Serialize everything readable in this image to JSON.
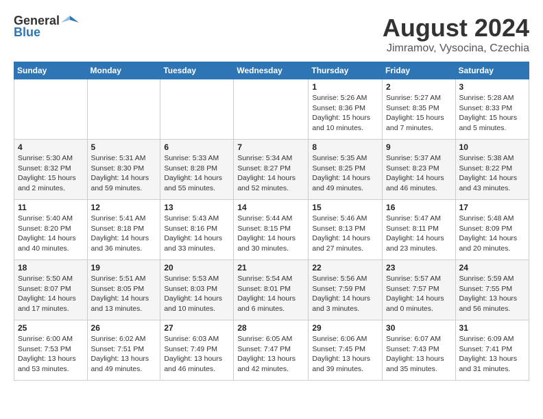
{
  "header": {
    "logo_general": "General",
    "logo_blue": "Blue",
    "month_title": "August 2024",
    "location": "Jimramov, Vysocina, Czechia"
  },
  "days_of_week": [
    "Sunday",
    "Monday",
    "Tuesday",
    "Wednesday",
    "Thursday",
    "Friday",
    "Saturday"
  ],
  "weeks": [
    [
      {
        "day": "",
        "info": ""
      },
      {
        "day": "",
        "info": ""
      },
      {
        "day": "",
        "info": ""
      },
      {
        "day": "",
        "info": ""
      },
      {
        "day": "1",
        "info": "Sunrise: 5:26 AM\nSunset: 8:36 PM\nDaylight: 15 hours\nand 10 minutes."
      },
      {
        "day": "2",
        "info": "Sunrise: 5:27 AM\nSunset: 8:35 PM\nDaylight: 15 hours\nand 7 minutes."
      },
      {
        "day": "3",
        "info": "Sunrise: 5:28 AM\nSunset: 8:33 PM\nDaylight: 15 hours\nand 5 minutes."
      }
    ],
    [
      {
        "day": "4",
        "info": "Sunrise: 5:30 AM\nSunset: 8:32 PM\nDaylight: 15 hours\nand 2 minutes."
      },
      {
        "day": "5",
        "info": "Sunrise: 5:31 AM\nSunset: 8:30 PM\nDaylight: 14 hours\nand 59 minutes."
      },
      {
        "day": "6",
        "info": "Sunrise: 5:33 AM\nSunset: 8:28 PM\nDaylight: 14 hours\nand 55 minutes."
      },
      {
        "day": "7",
        "info": "Sunrise: 5:34 AM\nSunset: 8:27 PM\nDaylight: 14 hours\nand 52 minutes."
      },
      {
        "day": "8",
        "info": "Sunrise: 5:35 AM\nSunset: 8:25 PM\nDaylight: 14 hours\nand 49 minutes."
      },
      {
        "day": "9",
        "info": "Sunrise: 5:37 AM\nSunset: 8:23 PM\nDaylight: 14 hours\nand 46 minutes."
      },
      {
        "day": "10",
        "info": "Sunrise: 5:38 AM\nSunset: 8:22 PM\nDaylight: 14 hours\nand 43 minutes."
      }
    ],
    [
      {
        "day": "11",
        "info": "Sunrise: 5:40 AM\nSunset: 8:20 PM\nDaylight: 14 hours\nand 40 minutes."
      },
      {
        "day": "12",
        "info": "Sunrise: 5:41 AM\nSunset: 8:18 PM\nDaylight: 14 hours\nand 36 minutes."
      },
      {
        "day": "13",
        "info": "Sunrise: 5:43 AM\nSunset: 8:16 PM\nDaylight: 14 hours\nand 33 minutes."
      },
      {
        "day": "14",
        "info": "Sunrise: 5:44 AM\nSunset: 8:15 PM\nDaylight: 14 hours\nand 30 minutes."
      },
      {
        "day": "15",
        "info": "Sunrise: 5:46 AM\nSunset: 8:13 PM\nDaylight: 14 hours\nand 27 minutes."
      },
      {
        "day": "16",
        "info": "Sunrise: 5:47 AM\nSunset: 8:11 PM\nDaylight: 14 hours\nand 23 minutes."
      },
      {
        "day": "17",
        "info": "Sunrise: 5:48 AM\nSunset: 8:09 PM\nDaylight: 14 hours\nand 20 minutes."
      }
    ],
    [
      {
        "day": "18",
        "info": "Sunrise: 5:50 AM\nSunset: 8:07 PM\nDaylight: 14 hours\nand 17 minutes."
      },
      {
        "day": "19",
        "info": "Sunrise: 5:51 AM\nSunset: 8:05 PM\nDaylight: 14 hours\nand 13 minutes."
      },
      {
        "day": "20",
        "info": "Sunrise: 5:53 AM\nSunset: 8:03 PM\nDaylight: 14 hours\nand 10 minutes."
      },
      {
        "day": "21",
        "info": "Sunrise: 5:54 AM\nSunset: 8:01 PM\nDaylight: 14 hours\nand 6 minutes."
      },
      {
        "day": "22",
        "info": "Sunrise: 5:56 AM\nSunset: 7:59 PM\nDaylight: 14 hours\nand 3 minutes."
      },
      {
        "day": "23",
        "info": "Sunrise: 5:57 AM\nSunset: 7:57 PM\nDaylight: 14 hours\nand 0 minutes."
      },
      {
        "day": "24",
        "info": "Sunrise: 5:59 AM\nSunset: 7:55 PM\nDaylight: 13 hours\nand 56 minutes."
      }
    ],
    [
      {
        "day": "25",
        "info": "Sunrise: 6:00 AM\nSunset: 7:53 PM\nDaylight: 13 hours\nand 53 minutes."
      },
      {
        "day": "26",
        "info": "Sunrise: 6:02 AM\nSunset: 7:51 PM\nDaylight: 13 hours\nand 49 minutes."
      },
      {
        "day": "27",
        "info": "Sunrise: 6:03 AM\nSunset: 7:49 PM\nDaylight: 13 hours\nand 46 minutes."
      },
      {
        "day": "28",
        "info": "Sunrise: 6:05 AM\nSunset: 7:47 PM\nDaylight: 13 hours\nand 42 minutes."
      },
      {
        "day": "29",
        "info": "Sunrise: 6:06 AM\nSunset: 7:45 PM\nDaylight: 13 hours\nand 39 minutes."
      },
      {
        "day": "30",
        "info": "Sunrise: 6:07 AM\nSunset: 7:43 PM\nDaylight: 13 hours\nand 35 minutes."
      },
      {
        "day": "31",
        "info": "Sunrise: 6:09 AM\nSunset: 7:41 PM\nDaylight: 13 hours\nand 31 minutes."
      }
    ]
  ]
}
